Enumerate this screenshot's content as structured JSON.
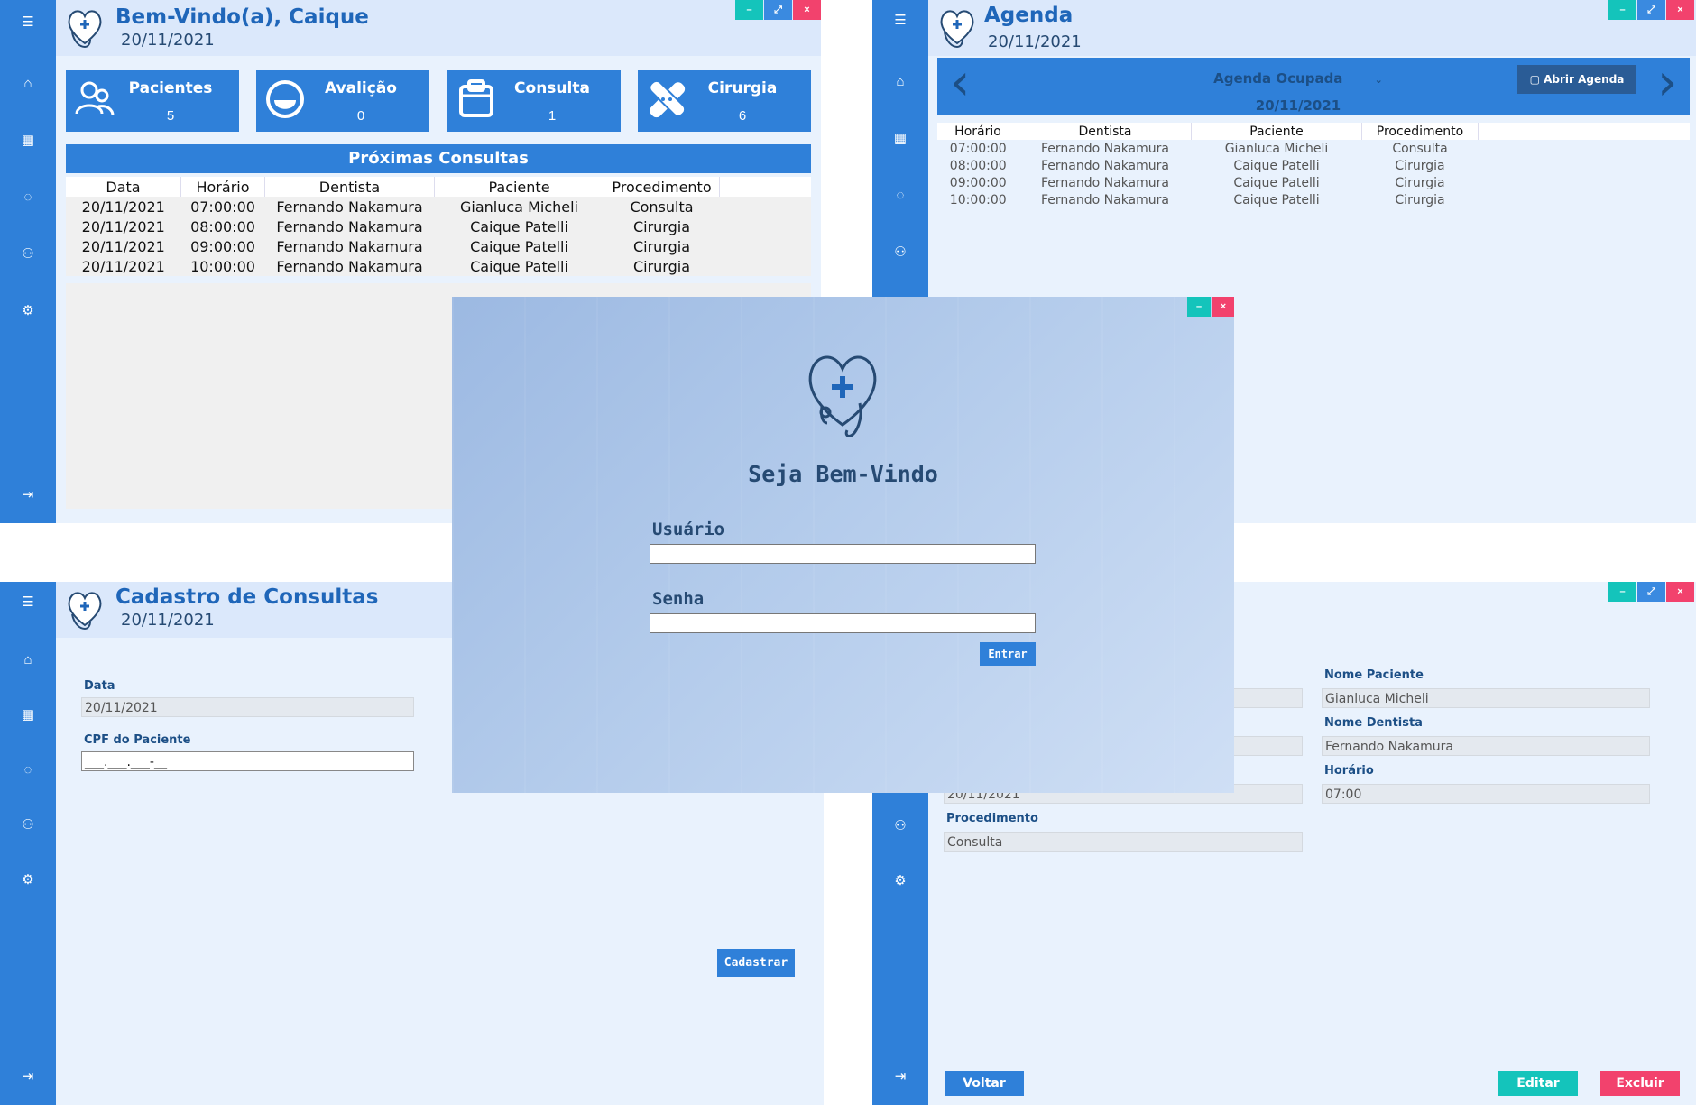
{
  "home": {
    "title": "Bem-Vindo(a), Caique",
    "date": "20/11/2021",
    "cards": [
      {
        "label": "Pacientes",
        "value": "5",
        "icon": "patients-icon"
      },
      {
        "label": "Avalição",
        "value": "0",
        "icon": "evaluation-icon"
      },
      {
        "label": "Consulta",
        "value": "1",
        "icon": "consultation-icon"
      },
      {
        "label": "Cirurgia",
        "value": "6",
        "icon": "surgery-icon"
      }
    ],
    "section_title": "Próximas Consultas",
    "table": {
      "headers": [
        "Data",
        "Horário",
        "Dentista",
        "Paciente",
        "Procedimento"
      ],
      "rows": [
        [
          "20/11/2021",
          "07:00:00",
          "Fernando Nakamura",
          "Gianluca Micheli",
          "Consulta"
        ],
        [
          "20/11/2021",
          "08:00:00",
          "Fernando Nakamura",
          "Caique Patelli",
          "Cirurgia"
        ],
        [
          "20/11/2021",
          "09:00:00",
          "Fernando Nakamura",
          "Caique Patelli",
          "Cirurgia"
        ],
        [
          "20/11/2021",
          "10:00:00",
          "Fernando Nakamura",
          "Caique Patelli",
          "Cirurgia"
        ]
      ]
    }
  },
  "agenda": {
    "title": "Agenda",
    "date": "20/11/2021",
    "filter_label": "Agenda Ocupada",
    "nav_date": "20/11/2021",
    "open_button": "Abrir Agenda",
    "prev_glyph": "‹",
    "next_glyph": "›",
    "table": {
      "headers": [
        "Horário",
        "Dentista",
        "Paciente",
        "Procedimento"
      ],
      "rows": [
        [
          "07:00:00",
          "Fernando Nakamura",
          "Gianluca Micheli",
          "Consulta"
        ],
        [
          "08:00:00",
          "Fernando Nakamura",
          "Caique Patelli",
          "Cirurgia"
        ],
        [
          "09:00:00",
          "Fernando Nakamura",
          "Caique Patelli",
          "Cirurgia"
        ],
        [
          "10:00:00",
          "Fernando Nakamura",
          "Caique Patelli",
          "Cirurgia"
        ]
      ]
    }
  },
  "cadastro": {
    "title": "Cadastro de Consultas",
    "date": "20/11/2021",
    "data_label": "Data",
    "data_value": "20/11/2021",
    "cpf_label": "CPF do Paciente",
    "cpf_value": "___.___.___-__",
    "submit": "Cadastrar"
  },
  "detail": {
    "nome_paciente_label": "Nome Paciente",
    "nome_paciente_value": "Gianluca Micheli",
    "nome_dentista_label": "Nome Dentista",
    "nome_dentista_value": "Fernando Nakamura",
    "horario_label": "Horário",
    "horario_value": "07:00",
    "data_partial": "20/11/2021",
    "procedimento_label": "Procedimento",
    "procedimento_value": "Consulta",
    "voltar": "Voltar",
    "editar": "Editar",
    "excluir": "Excluir"
  },
  "login": {
    "welcome": "Seja Bem-Vindo",
    "user_label": "Usuário",
    "user_value": "",
    "pass_label": "Senha",
    "pass_value": "",
    "submit": "Entrar"
  },
  "window_controls": {
    "minimize": "–",
    "maximize": "⤢",
    "close": "×"
  },
  "colors": {
    "primary": "#2f80d9",
    "header_bg": "#dbe8fb",
    "panel_bg": "#e9f2fd",
    "teal": "#14c4bb",
    "pink": "#f2426d",
    "title": "#1f66b9"
  }
}
